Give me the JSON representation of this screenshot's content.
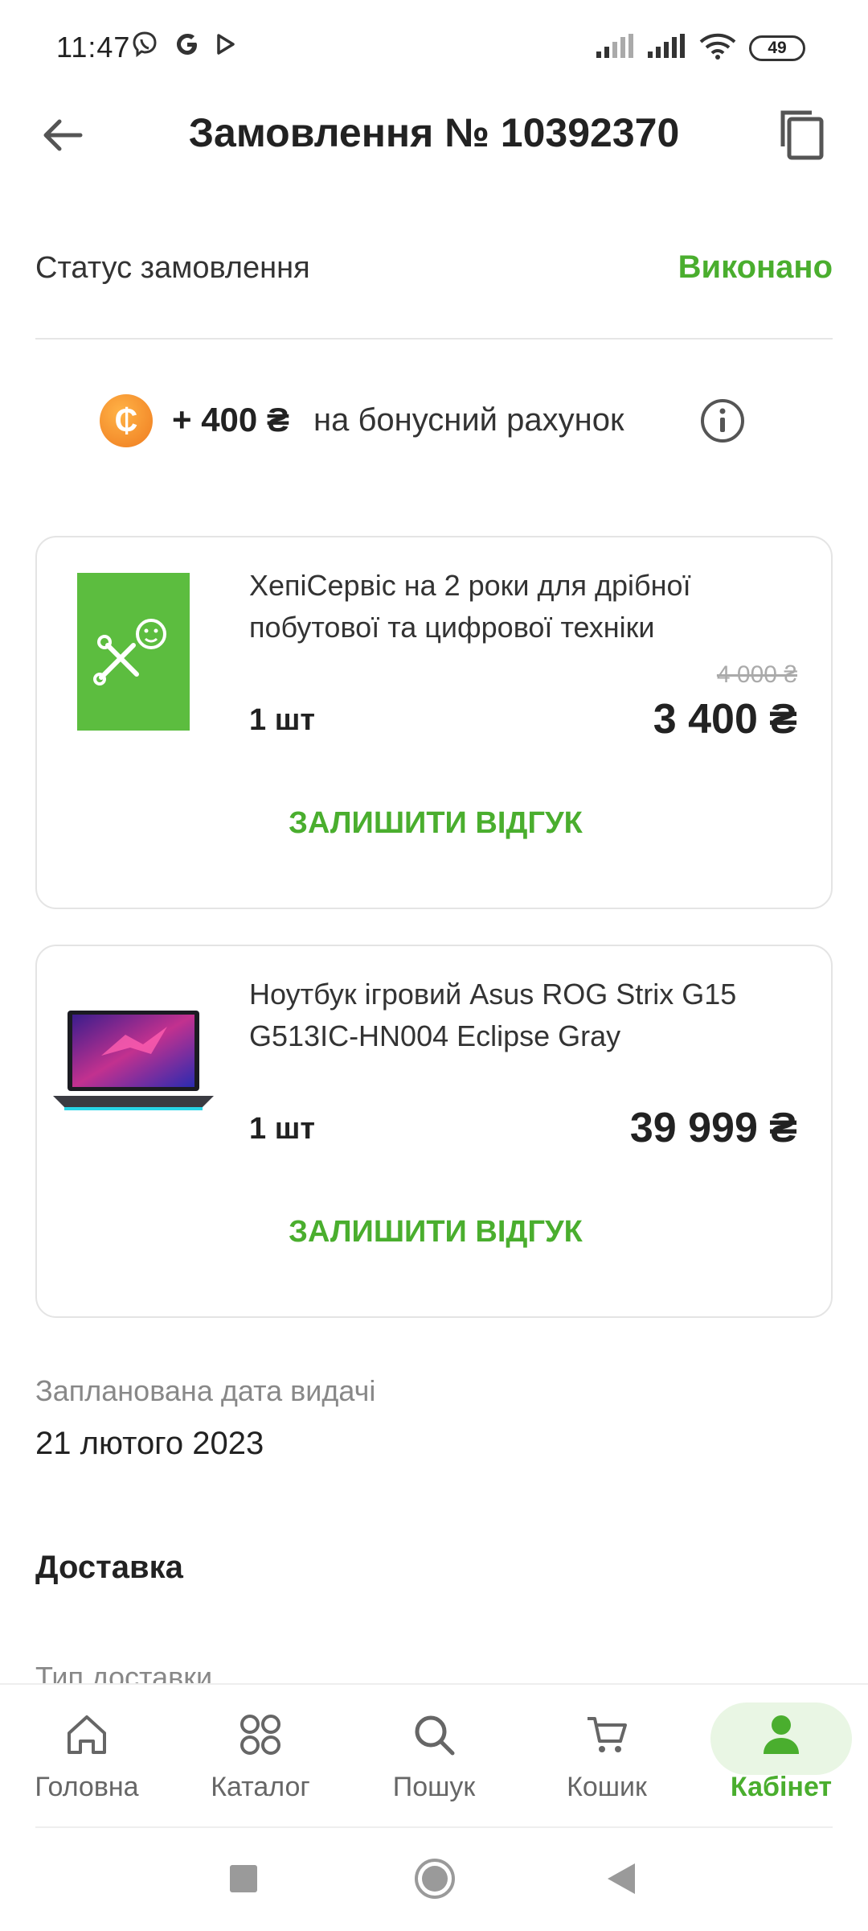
{
  "status_bar": {
    "time": "11:47",
    "icons": [
      "viber-icon",
      "google-icon",
      "play-icon"
    ],
    "battery": "49"
  },
  "header": {
    "title": "Замовлення № 10392370"
  },
  "order_status": {
    "label": "Статус замовлення",
    "value": "Виконано",
    "value_color": "#4aae2e"
  },
  "bonus": {
    "coin_symbol": "₵",
    "amount": "+ 400 ₴",
    "text": "на бонусний рахунок"
  },
  "products": [
    {
      "name": "ХепіСервіс на 2 роки для дрібної побутової та цифрової техніки",
      "old_price": "4 000 ₴",
      "quantity": "1 шт",
      "price": "3 400 ₴",
      "review_label": "ЗАЛИШИТИ ВІДГУК"
    },
    {
      "name": "Ноутбук ігровий Asus ROG Strix G15 G513IC-HN004 Eclipse Gray",
      "quantity": "1 шт",
      "price": "39 999 ₴",
      "review_label": "ЗАЛИШИТИ ВІДГУК"
    }
  ],
  "delivery_date": {
    "label": "Запланована дата видачі",
    "value": "21 лютого 2023"
  },
  "delivery": {
    "title": "Доставка",
    "type_label": "Тип доставки"
  },
  "bottom_nav": {
    "items": [
      {
        "label": "Головна",
        "icon": "home-icon"
      },
      {
        "label": "Каталог",
        "icon": "catalog-icon"
      },
      {
        "label": "Пошук",
        "icon": "search-icon"
      },
      {
        "label": "Кошик",
        "icon": "cart-icon"
      },
      {
        "label": "Кабінет",
        "icon": "profile-icon",
        "active": true
      }
    ]
  },
  "colors": {
    "accent": "#4aae2e",
    "active_bg": "#e9f6e4",
    "coin": "#ef7b1f"
  }
}
